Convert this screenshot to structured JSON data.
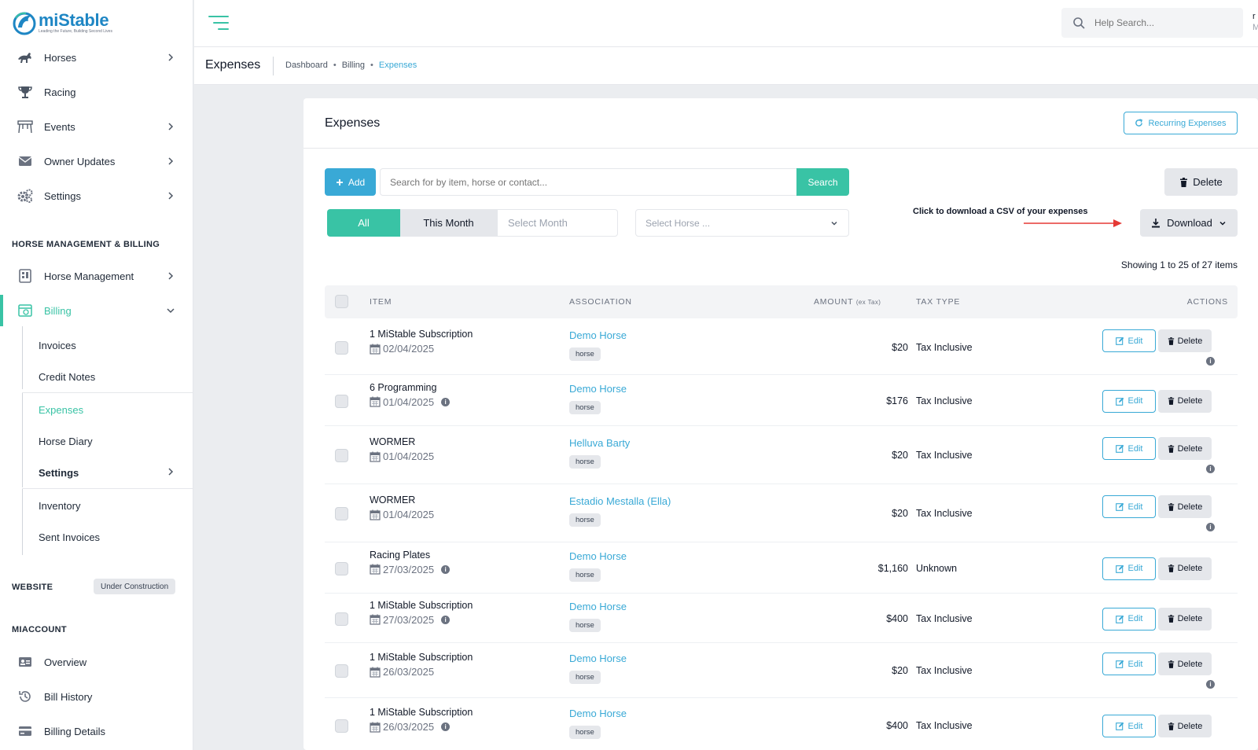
{
  "brand": {
    "name_prefix": "mi",
    "name_suffix": "Stable",
    "tagline": "Leading the Future, Building Second Lives"
  },
  "sidebar": {
    "main_items": [
      {
        "label": "Horses",
        "icon": "horse-icon",
        "has_children": true
      },
      {
        "label": "Racing",
        "icon": "trophy-icon",
        "has_children": false
      },
      {
        "label": "Events",
        "icon": "events-icon",
        "has_children": true
      },
      {
        "label": "Owner Updates",
        "icon": "envelope-icon",
        "has_children": true
      },
      {
        "label": "Settings",
        "icon": "gears-icon",
        "has_children": true
      }
    ],
    "section_management": "HORSE MANAGEMENT & BILLING",
    "management_items": [
      {
        "label": "Horse Management",
        "icon": "clipboard-icon",
        "has_children": true
      },
      {
        "label": "Billing",
        "icon": "billing-icon",
        "expanded": true,
        "active": true
      }
    ],
    "billing_subitems": [
      {
        "label": "Invoices"
      },
      {
        "label": "Credit Notes"
      },
      {
        "label": "Expenses",
        "active": true
      },
      {
        "label": "Horse Diary"
      },
      {
        "label": "Settings",
        "has_children": true
      },
      {
        "label": "Inventory"
      },
      {
        "label": "Sent Invoices"
      }
    ],
    "section_website": "WEBSITE",
    "website_badge": "Under Construction",
    "section_account": "MIACCOUNT",
    "account_items": [
      {
        "label": "Overview",
        "icon": "id-card-icon"
      },
      {
        "label": "Bill History",
        "icon": "history-icon"
      },
      {
        "label": "Billing Details",
        "icon": "credit-card-icon"
      }
    ]
  },
  "header": {
    "help_search_placeholder": "Help Search...",
    "user_initial": "r",
    "user_sub": "M"
  },
  "subheader": {
    "title": "Expenses",
    "breadcrumb": [
      "Dashboard",
      "Billing",
      "Expenses"
    ]
  },
  "card": {
    "title": "Expenses",
    "recurring_label": "Recurring Expenses",
    "add_label": "Add",
    "search_placeholder": "Search for by item, horse or contact...",
    "search_label": "Search",
    "delete_label": "Delete",
    "filter_all": "All",
    "filter_this_month": "This Month",
    "filter_select_month": "Select Month",
    "horse_select_placeholder": "Select Horse ...",
    "annotation": "Click to download a CSV of your expenses",
    "download_label": "Download",
    "showing_text": "Showing 1 to 25 of 27 items"
  },
  "table": {
    "columns": {
      "item": "ITEM",
      "association": "ASSOCIATION",
      "amount": "AMOUNT",
      "amount_note": "(ex Tax)",
      "tax_type": "TAX TYPE",
      "actions": "ACTIONS"
    },
    "edit_label": "Edit",
    "delete_label": "Delete",
    "rows": [
      {
        "item": "1 MiStable Subscription",
        "date": "02/04/2025",
        "date_info": false,
        "association": "Demo Horse",
        "tag": "horse",
        "amount": "$20",
        "tax_type": "Tax Inclusive",
        "action_info": true
      },
      {
        "item": "6 Programming",
        "date": "01/04/2025",
        "date_info": true,
        "association": "Demo Horse",
        "tag": "horse",
        "amount": "$176",
        "tax_type": "Tax Inclusive",
        "action_info": false
      },
      {
        "item": "WORMER",
        "date": "01/04/2025",
        "date_info": false,
        "association": "Helluva Barty",
        "tag": "horse",
        "amount": "$20",
        "tax_type": "Tax Inclusive",
        "action_info": true
      },
      {
        "item": "WORMER",
        "date": "01/04/2025",
        "date_info": false,
        "association": "Estadio Mestalla (Ella)",
        "tag": "horse",
        "amount": "$20",
        "tax_type": "Tax Inclusive",
        "action_info": true
      },
      {
        "item": "Racing Plates",
        "date": "27/03/2025",
        "date_info": true,
        "association": "Demo Horse",
        "tag": "horse",
        "amount": "$1,160",
        "tax_type": "Unknown",
        "action_info": false
      },
      {
        "item": "1 MiStable Subscription",
        "date": "27/03/2025",
        "date_info": true,
        "association": "Demo Horse",
        "tag": "horse",
        "amount": "$400",
        "tax_type": "Tax Inclusive",
        "action_info": false
      },
      {
        "item": "1 MiStable Subscription",
        "date": "26/03/2025",
        "date_info": false,
        "association": "Demo Horse",
        "tag": "horse",
        "amount": "$20",
        "tax_type": "Tax Inclusive",
        "action_info": true
      },
      {
        "item": "1 MiStable Subscription",
        "date": "26/03/2025",
        "date_info": true,
        "association": "Demo Horse",
        "tag": "horse",
        "amount": "$400",
        "tax_type": "Tax Inclusive",
        "action_info": false
      }
    ]
  },
  "colors": {
    "brand_blue": "#1e86c4",
    "accent_teal": "#39c3a5",
    "link_blue": "#39a9d6",
    "arrow_red": "#e53935"
  }
}
